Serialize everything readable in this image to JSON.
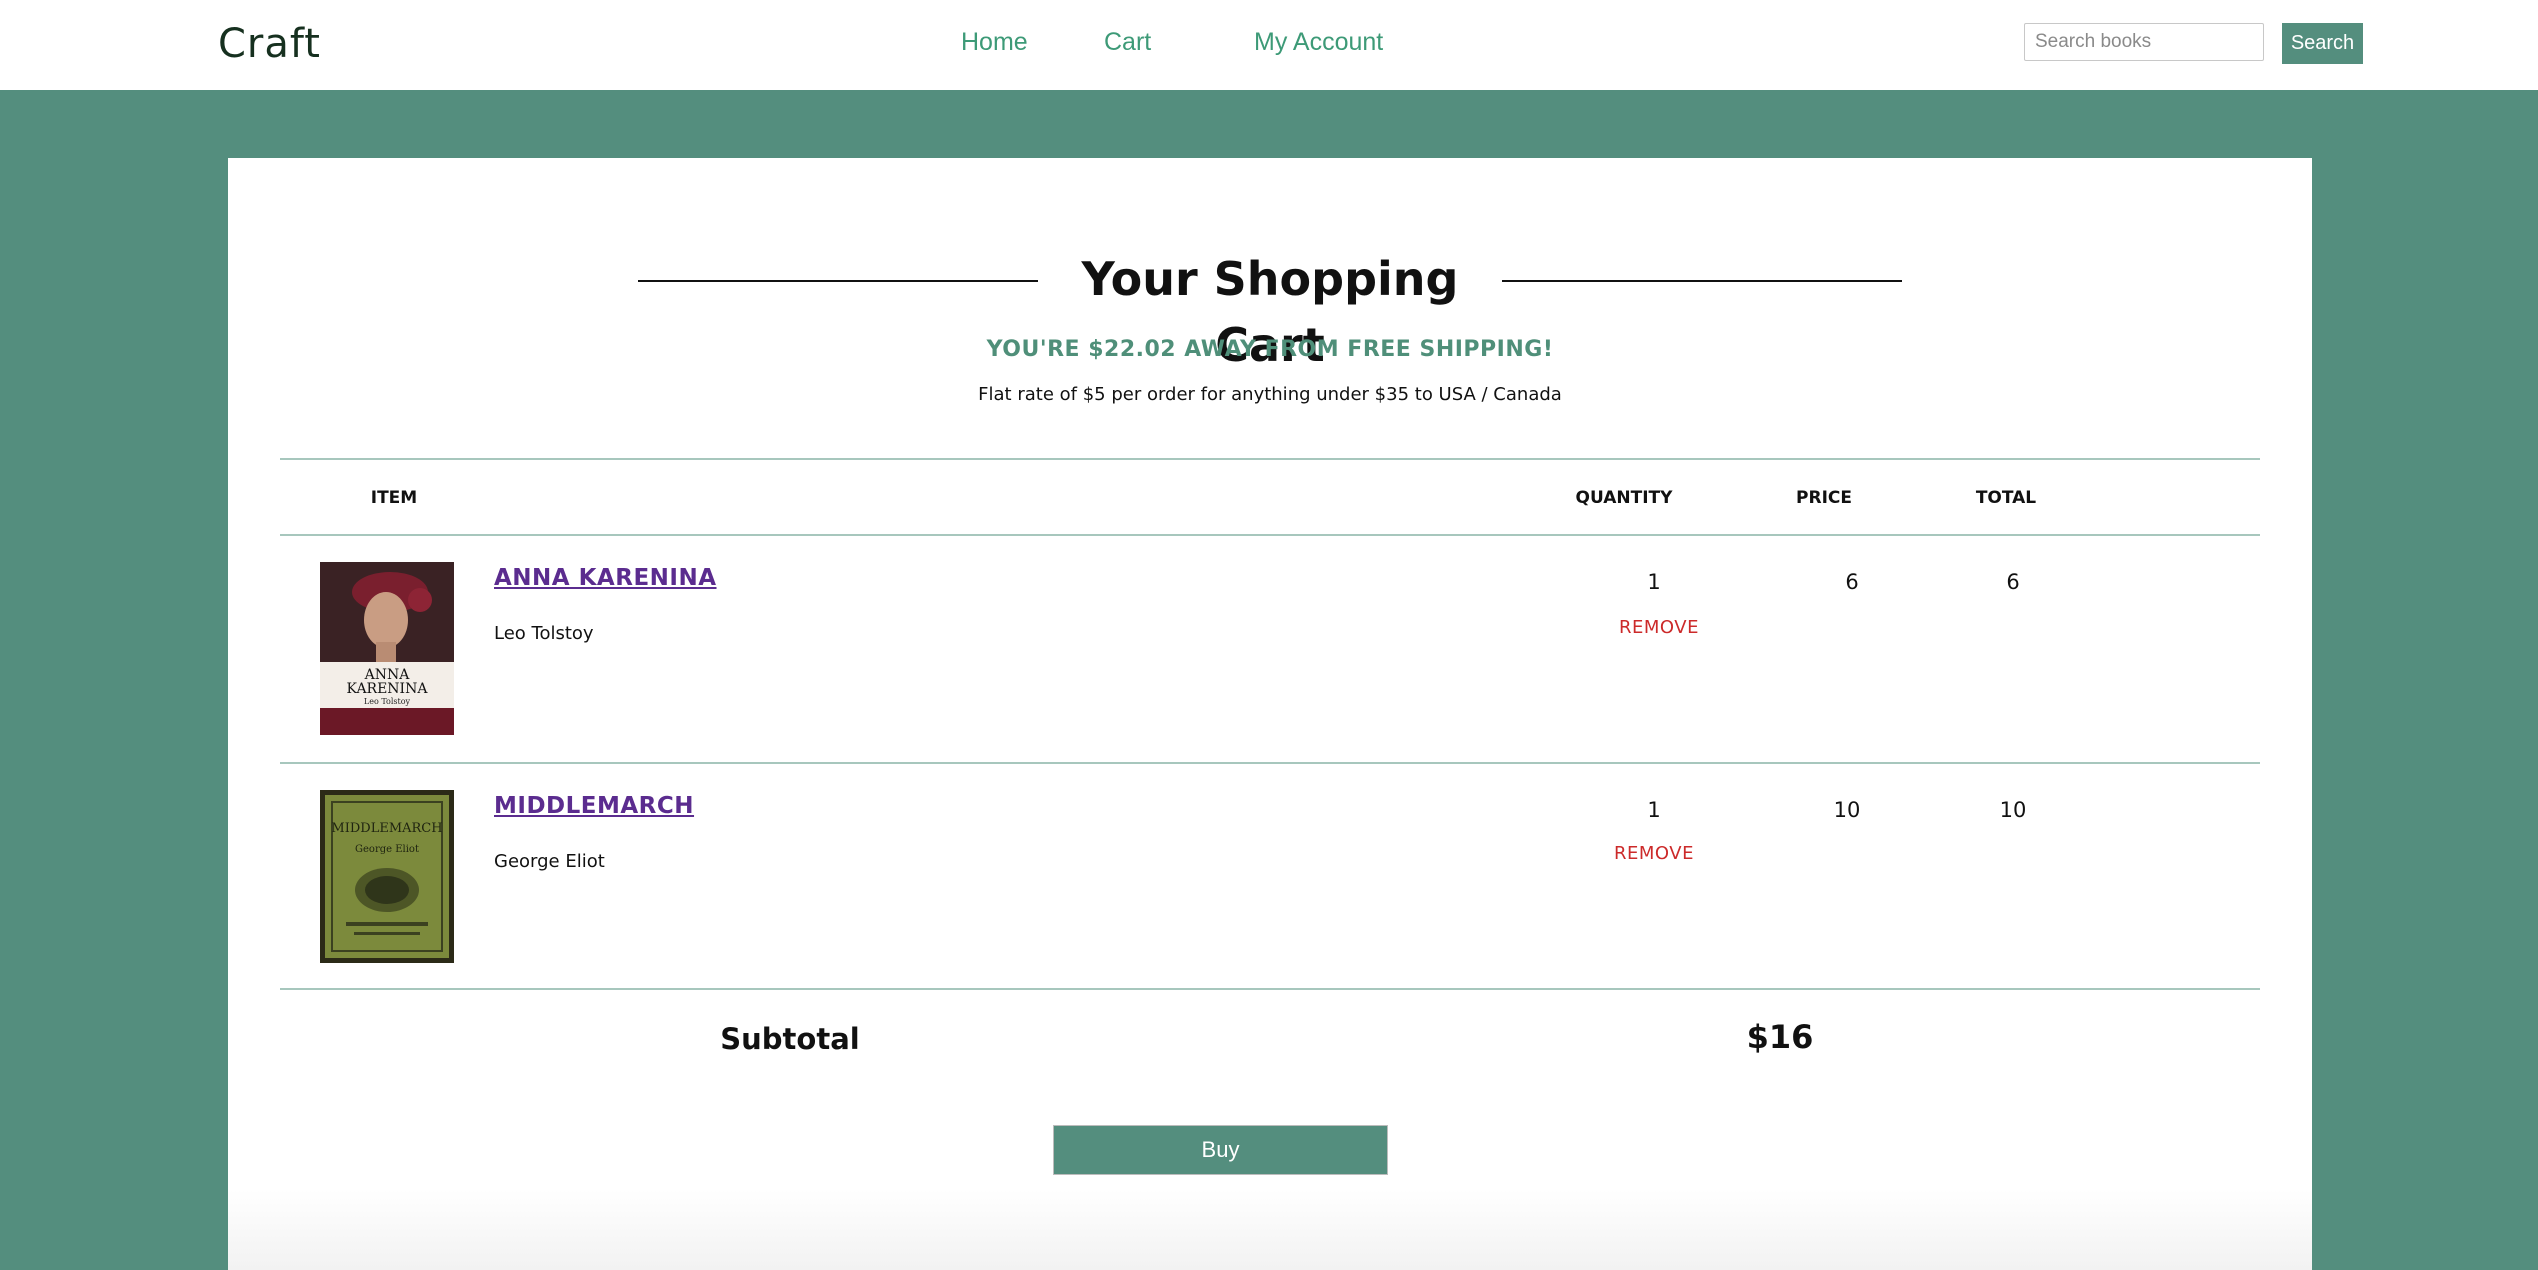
{
  "header": {
    "logo": "Craft",
    "nav": [
      {
        "label": "Home"
      },
      {
        "label": "Cart"
      },
      {
        "label": "My Account"
      }
    ],
    "search": {
      "placeholder": "Search books",
      "button_label": "Search"
    }
  },
  "cart": {
    "title": "Your Shopping Cart",
    "shipping_message": "YOU'RE $22.02 AWAY FROM FREE SHIPPING!",
    "shipping_note": "Flat rate of $5 per order for anything under $35 to USA / Canada",
    "columns": {
      "item": "ITEM",
      "quantity": "QUANTITY",
      "price": "PRICE",
      "total": "TOTAL"
    },
    "items": [
      {
        "title": "ANNA KARENINA",
        "author": "Leo Tolstoy",
        "cover_text": [
          "ANNA",
          "KARENINA",
          "Leo Tolstoy"
        ],
        "quantity": "1",
        "price": "6",
        "total": "6",
        "remove_label": "REMOVE"
      },
      {
        "title": "MIDDLEMARCH",
        "author": "George Eliot",
        "cover_text": [
          "MIDDLEMARCH",
          "George Eliot"
        ],
        "quantity": "1",
        "price": "10",
        "total": "10",
        "remove_label": "REMOVE"
      }
    ],
    "subtotal_label": "Subtotal",
    "subtotal_value": "$16",
    "buy_label": "Buy"
  },
  "colors": {
    "brand_green": "#548e7e",
    "nav_link": "#3d9a77",
    "title_link": "#5b2c8f",
    "remove": "#cc2a2a",
    "shipping_msg": "#4f8f79"
  }
}
